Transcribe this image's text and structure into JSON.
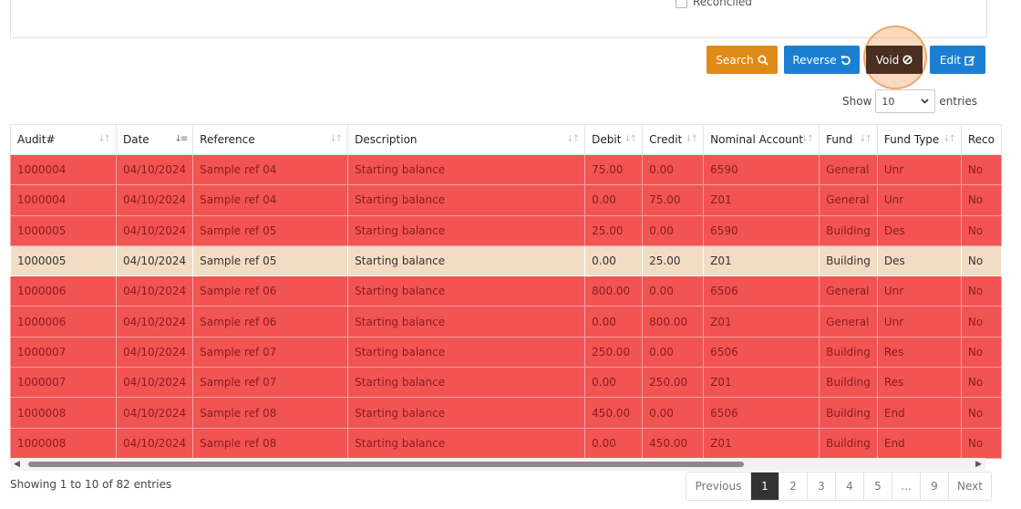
{
  "filters": {
    "reconciled_label": "Reconciled"
  },
  "toolbar": {
    "search_label": "Search",
    "reverse_label": "Reverse",
    "void_label": "Void",
    "edit_label": "Edit"
  },
  "length": {
    "show_label": "Show",
    "value": "10",
    "entries_label": "entries"
  },
  "table": {
    "headers": [
      "Audit#",
      "Date",
      "Reference",
      "Description",
      "Debit",
      "Credit",
      "Nominal Account",
      "Fund",
      "Fund Type",
      "Reco"
    ],
    "rows": [
      [
        "1000004",
        "04/10/2024",
        "Sample ref 04",
        "Starting balance",
        "75.00",
        "0.00",
        "6590",
        "General",
        "Unr",
        "No"
      ],
      [
        "1000004",
        "04/10/2024",
        "Sample ref 04",
        "Starting balance",
        "0.00",
        "75.00",
        "Z01",
        "General",
        "Unr",
        "No"
      ],
      [
        "1000005",
        "04/10/2024",
        "Sample ref 05",
        "Starting balance",
        "25.00",
        "0.00",
        "6590",
        "Building",
        "Des",
        "No"
      ],
      [
        "1000005",
        "04/10/2024",
        "Sample ref 05",
        "Starting balance",
        "0.00",
        "25.00",
        "Z01",
        "Building",
        "Des",
        "No"
      ],
      [
        "1000006",
        "04/10/2024",
        "Sample ref 06",
        "Starting balance",
        "800.00",
        "0.00",
        "6506",
        "General",
        "Unr",
        "No"
      ],
      [
        "1000006",
        "04/10/2024",
        "Sample ref 06",
        "Starting balance",
        "0.00",
        "800.00",
        "Z01",
        "General",
        "Unr",
        "No"
      ],
      [
        "1000007",
        "04/10/2024",
        "Sample ref 07",
        "Starting balance",
        "250.00",
        "0.00",
        "6506",
        "Building",
        "Res",
        "No"
      ],
      [
        "1000007",
        "04/10/2024",
        "Sample ref 07",
        "Starting balance",
        "0.00",
        "250.00",
        "Z01",
        "Building",
        "Res",
        "No"
      ],
      [
        "1000008",
        "04/10/2024",
        "Sample ref 08",
        "Starting balance",
        "450.00",
        "0.00",
        "6506",
        "Building",
        "End",
        "No"
      ],
      [
        "1000008",
        "04/10/2024",
        "Sample ref 08",
        "Starting balance",
        "0.00",
        "450.00",
        "Z01",
        "Building",
        "End",
        "No"
      ]
    ],
    "selected_row": 3
  },
  "footer": {
    "info": "Showing 1 to 10 of 82 entries",
    "pages": [
      "Previous",
      "1",
      "2",
      "3",
      "4",
      "5",
      "...",
      "9",
      "Next"
    ],
    "active_page": "1"
  },
  "colors": {
    "row_highlight": "#f25454",
    "row_selected": "#f2dcc3",
    "search_button": "#e08a17",
    "primary_button": "#1b7fd1",
    "void_button": "#4a2e22"
  },
  "icons": {
    "search": "search-icon",
    "reverse": "undo-icon",
    "void": "ban-icon",
    "edit": "edit-icon"
  }
}
